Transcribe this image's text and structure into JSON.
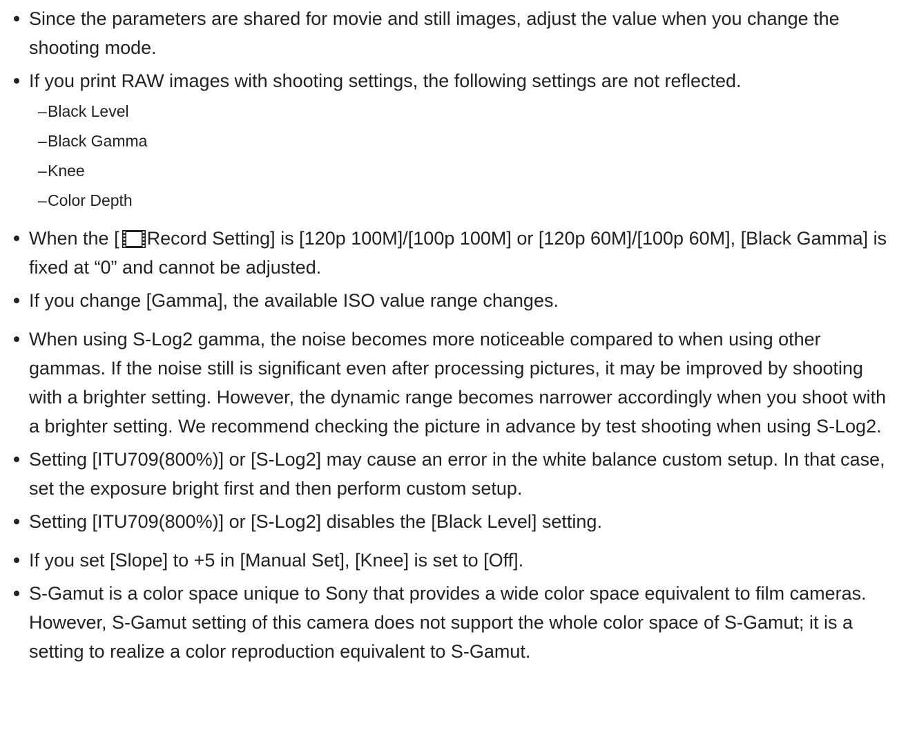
{
  "notes": {
    "item1": "Since the parameters are shared for movie and still images, adjust the value when you change the shooting mode.",
    "item2": "If you print RAW images with shooting settings, the following settings are not reflected.",
    "item2_sub": [
      "Black Level",
      "Black Gamma",
      "Knee",
      "Color Depth"
    ],
    "sub_dash": "–",
    "item3_pre": "When the [",
    "item3_icon": "movie-icon",
    "item3_post": "Record Setting] is [120p 100M]/[100p 100M] or [120p 60M]/[100p 60M], [Black Gamma] is fixed at “0” and cannot be adjusted.",
    "item4": "If you change [Gamma], the available ISO value range changes.",
    "item5": "When using S-Log2 gamma, the noise becomes more noticeable compared to when using other gammas. If the noise still is significant even after processing pictures, it may be improved by shooting with a brighter setting. However, the dynamic range becomes narrower accordingly when you shoot with a brighter setting. We recommend checking the picture in advance by test shooting when using S-Log2.",
    "item6": "Setting [ITU709(800%)] or [S-Log2] may cause an error in the white balance custom setup. In that case, set the exposure bright first and then perform custom setup.",
    "item7": "Setting [ITU709(800%)] or [S-Log2] disables the [Black Level] setting.",
    "item8": "If you set [Slope] to +5 in [Manual Set], [Knee] is set to [Off].",
    "item9": "S-Gamut is a color space unique to Sony that provides a wide color space equivalent to film cameras. However, S-Gamut setting of this camera does not support the whole color space of S-Gamut; it is a setting to realize a color reproduction equivalent to S-Gamut."
  },
  "colors": {
    "text": "#222222",
    "background": "#ffffff"
  }
}
